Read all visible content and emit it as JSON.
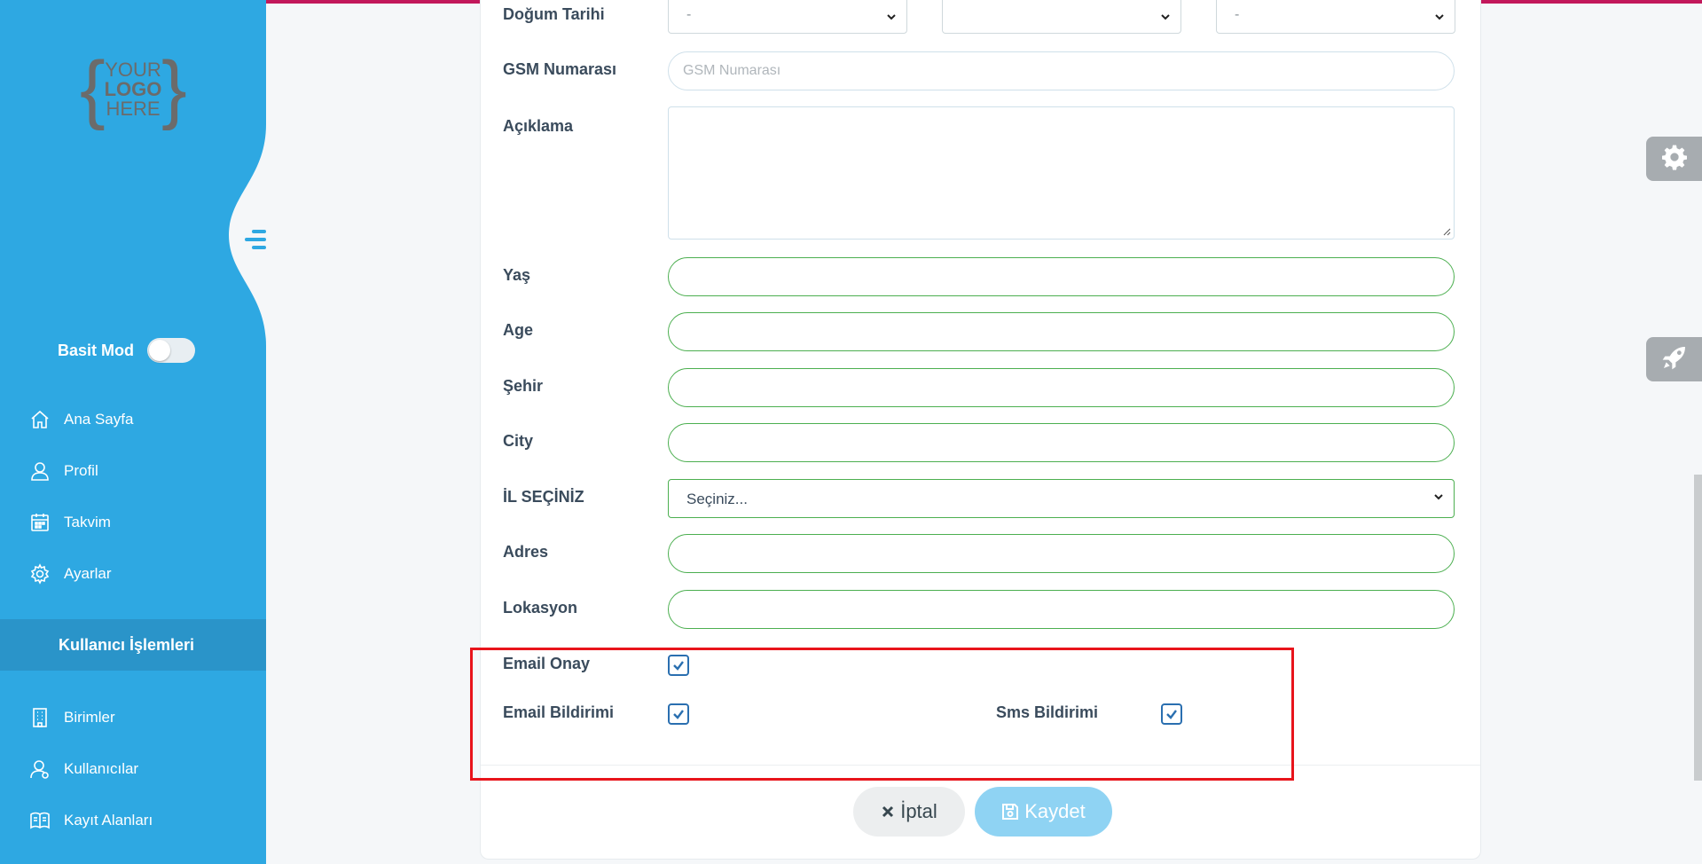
{
  "sidebar": {
    "logo": {
      "line1": "YOUR",
      "line2": "LOGO",
      "line3": "HERE"
    },
    "mode_label": "Basit Mod",
    "nav_main": [
      {
        "label": "Ana Sayfa",
        "icon": "home-icon"
      },
      {
        "label": "Profil",
        "icon": "user-icon"
      },
      {
        "label": "Takvim",
        "icon": "calendar-icon"
      },
      {
        "label": "Ayarlar",
        "icon": "gear-icon"
      }
    ],
    "section_title": "Kullanıcı İşlemleri",
    "nav_users": [
      {
        "label": "Birimler",
        "icon": "building-icon"
      },
      {
        "label": "Kullanıcılar",
        "icon": "users-icon"
      },
      {
        "label": "Kayıt Alanları",
        "icon": "book-icon"
      }
    ]
  },
  "form": {
    "birth_date": {
      "label": "Doğum Tarihi",
      "day": "-",
      "month": "",
      "year": "-"
    },
    "gsm": {
      "label": "GSM Numarası",
      "placeholder": "GSM Numarası"
    },
    "description": {
      "label": "Açıklama"
    },
    "age_tr": {
      "label": "Yaş"
    },
    "age_en": {
      "label": "Age"
    },
    "city_tr": {
      "label": "Şehir"
    },
    "city_en": {
      "label": "City"
    },
    "province": {
      "label": "İL SEÇİNİZ",
      "value": "Seçiniz..."
    },
    "address": {
      "label": "Adres"
    },
    "location": {
      "label": "Lokasyon"
    },
    "email_confirm": {
      "label": "Email Onay",
      "checked": true
    },
    "email_notify": {
      "label": "Email Bildirimi",
      "checked": true
    },
    "sms_notify": {
      "label": "Sms Bildirimi",
      "checked": true
    }
  },
  "buttons": {
    "cancel": "İptal",
    "save": "Kaydet"
  },
  "colors": {
    "sidebar": "#2ea8e2",
    "accent_top": "#c2185b",
    "valid_border": "#4caf50",
    "highlight": "#e8141b"
  }
}
